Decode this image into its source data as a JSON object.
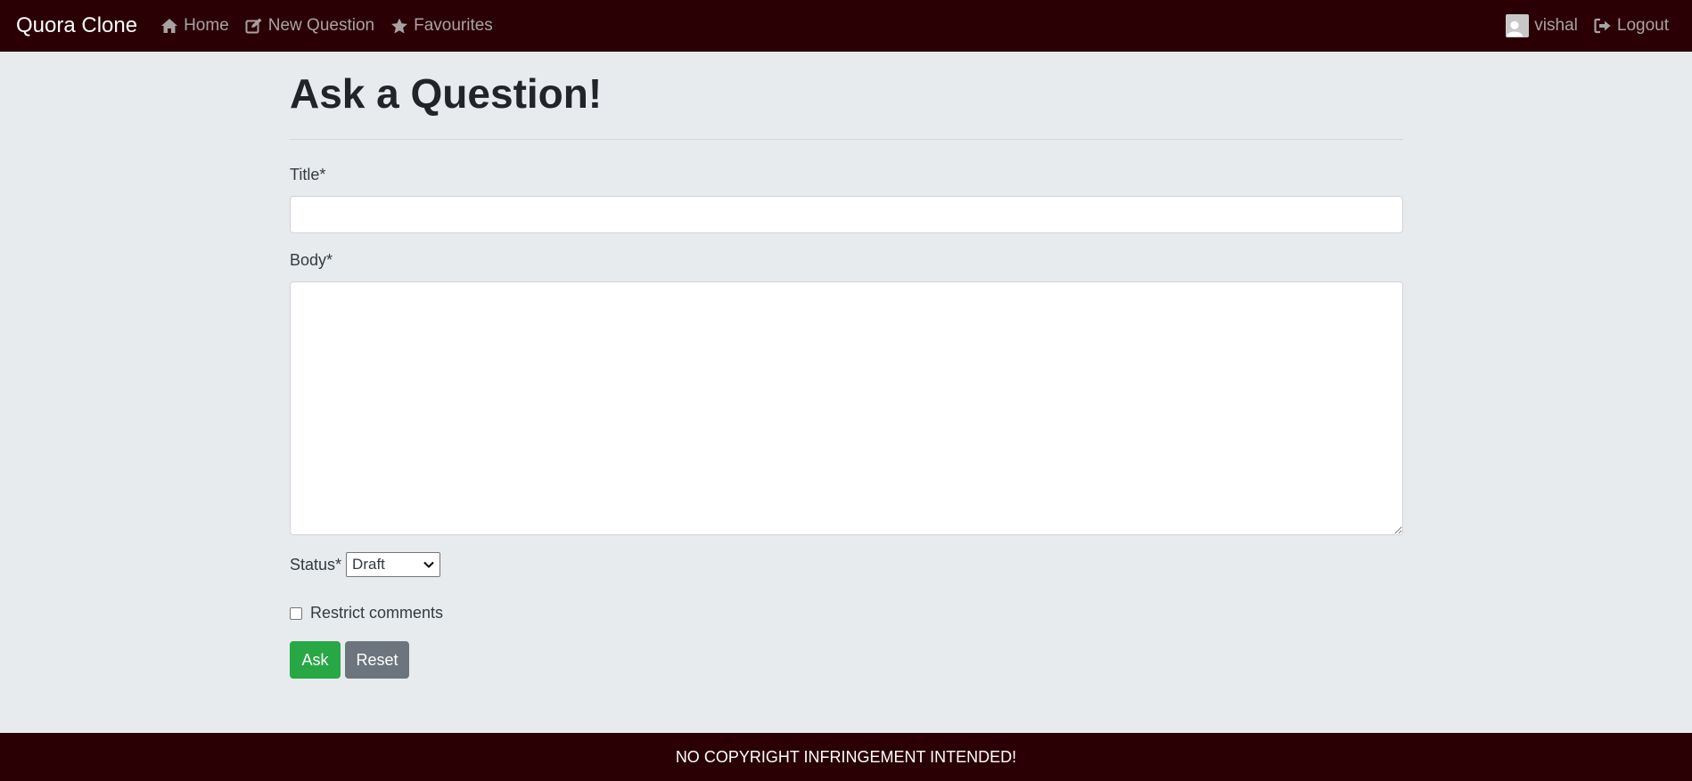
{
  "navbar": {
    "brand": "Quora Clone",
    "links": [
      {
        "label": "Home",
        "icon": "home-icon"
      },
      {
        "label": "New Question",
        "icon": "edit-icon"
      },
      {
        "label": "Favourites",
        "icon": "star-icon"
      }
    ],
    "user": {
      "name": "vishal",
      "icon": "avatar"
    },
    "logout": {
      "label": "Logout",
      "icon": "sign-out-icon"
    }
  },
  "form": {
    "heading": "Ask a Question!",
    "title_label": "Title*",
    "title_value": "",
    "body_label": "Body*",
    "body_value": "",
    "status_label": "Status*",
    "status_selected": "Draft",
    "restrict_label": "Restrict comments",
    "restrict_checked": false,
    "ask_label": "Ask",
    "reset_label": "Reset"
  },
  "footer": {
    "text": "NO COPYRIGHT INFRINGEMENT INTENDED!"
  },
  "colors": {
    "navbar_bg": "#2a0004",
    "page_bg": "#e7ebee",
    "ask_button": "#28a745",
    "reset_button": "#6c757d",
    "nav_link": "#a9a2a3"
  }
}
